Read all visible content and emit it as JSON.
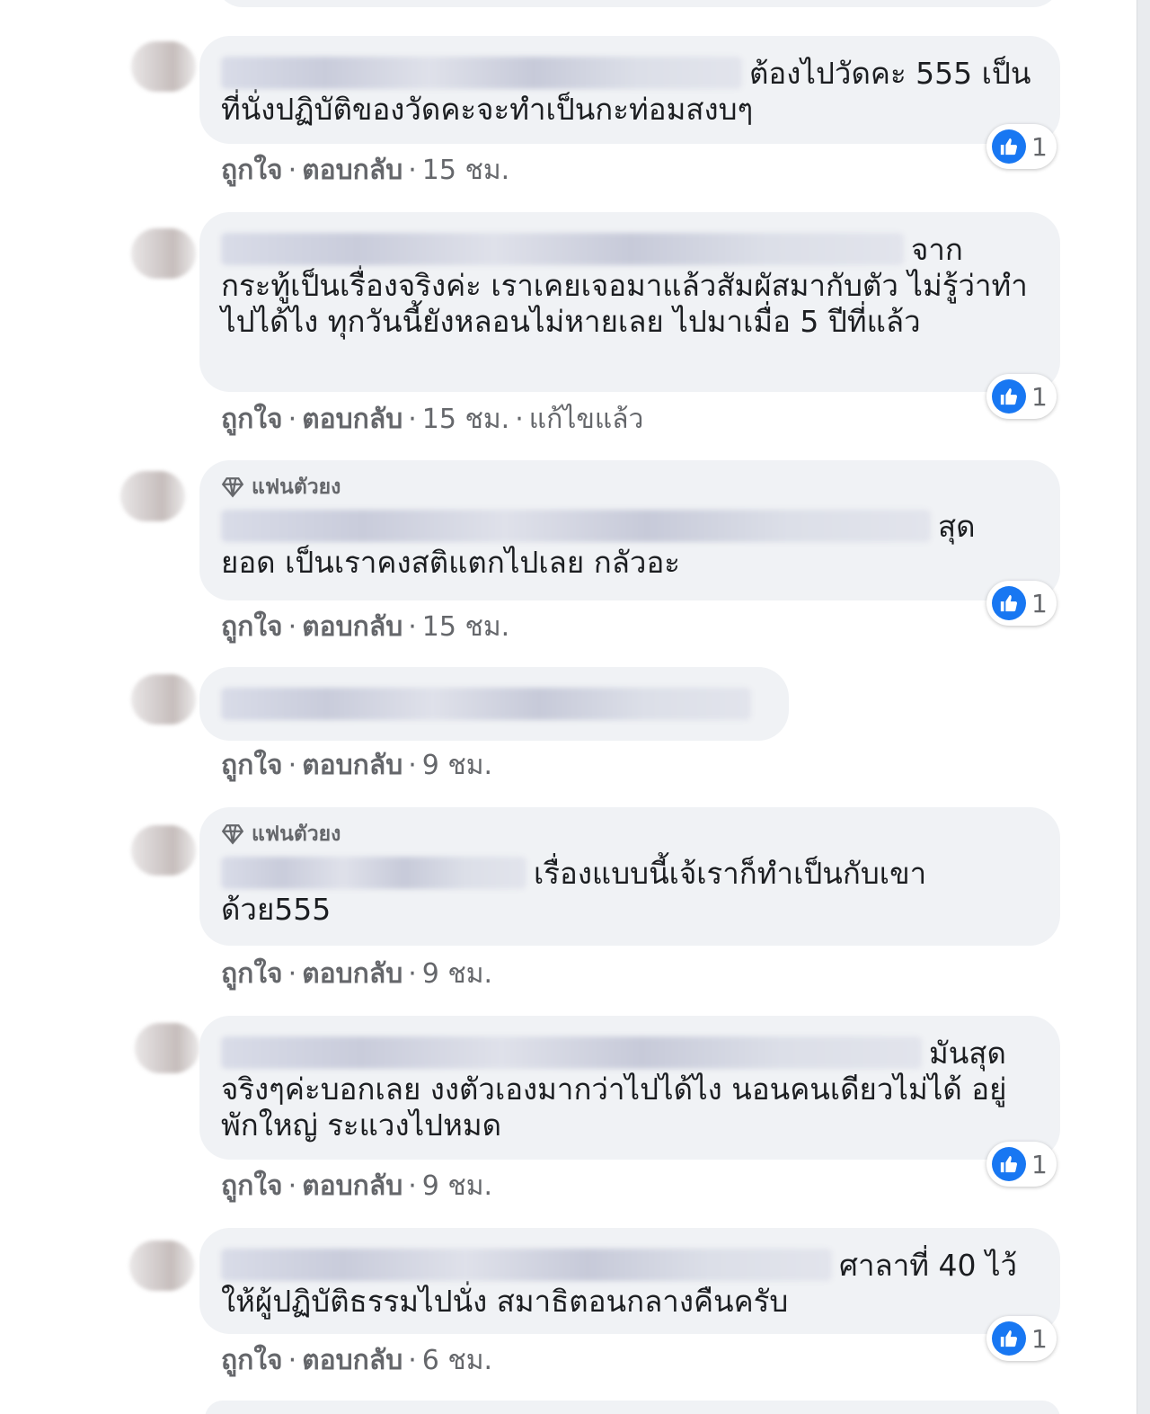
{
  "actions_labels": {
    "like": "ถูกใจ",
    "reply": "ตอบกลับ",
    "separator": "·"
  },
  "badge_label": "แฟนตัวยง",
  "comments": [
    {
      "text": "ต้องไปวัดคะ 555 เป็นที่นั่งปฏิบัติของวัดคะจะทำเป็นกะท่อมสงบๆ",
      "time": "15 ชม.",
      "reactions": "1"
    },
    {
      "text": "จาก กระทู้เป็นเรื่องจริงค่ะ เราเคยเจอมาแล้วสัมผัสมากับตัว ไม่รู้ว่าทำไปได้ไง ทุกวันนี้ยังหลอนไม่หายเลย ไปมาเมื่อ 5 ปีที่แล้ว",
      "time": "15 ชม.",
      "edited": "แก้ไขแล้ว",
      "reactions": "1"
    },
    {
      "text": "สุด ยอด เป็นเราคงสติแตกไปเลย กลัวอะ",
      "time": "15 ชม.",
      "reactions": "1"
    },
    {
      "text": "",
      "time": "9 ชม."
    },
    {
      "text": "เรื่องแบบนี้เจ้เราก็ทำเป็นกับเขา ด้วย555",
      "time": "9 ชม."
    },
    {
      "text": "มันสุด จริงๆค่ะบอกเลย งงตัวเองมากว่าไปได้ไง นอนคนเดียวไม่ได้ อยู่พักใหญ่ ระแวงไปหมด",
      "time": "9 ชม.",
      "reactions": "1"
    },
    {
      "text": "ศาลาที่ 40 ไว้ให้ผู้ปฏิบัติธรรมไปนั่ง สมาธิตอนกลางคืนครับ",
      "time": "6 ชม.",
      "reactions": "1"
    }
  ],
  "colors": {
    "bubble": "#f0f2f5",
    "meta_text": "#65676b",
    "body_text": "#1c1e21",
    "like_blue": "#1877f2"
  },
  "icons": {
    "badge": "diamond-icon",
    "reaction": "thumbs-up-icon"
  }
}
